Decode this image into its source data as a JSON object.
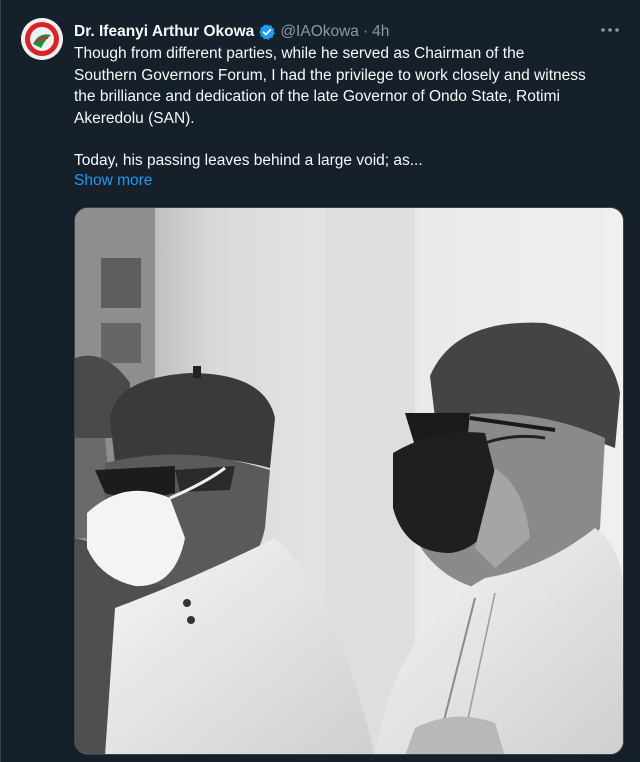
{
  "tweet": {
    "author_name": "Dr. Ifeanyi Arthur Okowa",
    "handle": "@IAOkowa",
    "separator": "·",
    "time": "4h",
    "text_lines": [
      "Though from different parties, while he served as Chairman of the",
      "Southern Governors Forum, I had the privilege to work closely and witness",
      "the brilliance and dedication of the late Governor of Ondo State, Rotimi",
      "Akeredolu (SAN)."
    ],
    "text_line_2": "Today, his passing leaves behind a large void; as...",
    "show_more": "Show more"
  },
  "icons": {
    "verified": "verified-badge-icon",
    "more": "more-options-icon"
  },
  "colors": {
    "background": "#15202b",
    "text": "#f7f9f9",
    "secondary_text": "#8b98a5",
    "link": "#1d9bf0",
    "verified": "#1d9bf0"
  },
  "media": {
    "description_type": "black-and-white photo",
    "content": "two men in caps and face masks"
  }
}
